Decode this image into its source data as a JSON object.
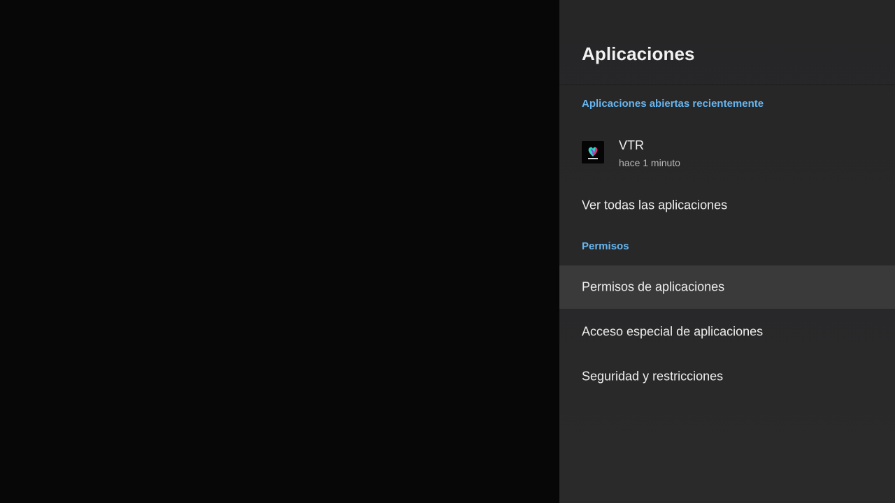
{
  "panel": {
    "title": "Aplicaciones",
    "sections": {
      "recent_header": "Aplicaciones abiertas recientemente",
      "permissions_header": "Permisos"
    },
    "recent_app": {
      "name": "VTR",
      "subtitle": "hace 1 minuto",
      "icon": "vtr-app-icon"
    },
    "items": {
      "see_all": "Ver todas las aplicaciones",
      "app_permissions": "Permisos de aplicaciones",
      "special_access": "Acceso especial de aplicaciones",
      "security": "Seguridad y restricciones"
    },
    "focused_item": "app_permissions"
  },
  "colors": {
    "accent": "#67b5ee",
    "panel_bg": "#282829",
    "focus_bg": "#3a3a3b",
    "background": "#070707"
  }
}
